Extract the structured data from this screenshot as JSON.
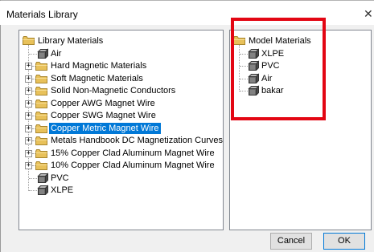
{
  "window": {
    "title": "Materials Library",
    "close_glyph": "✕"
  },
  "library_tree": {
    "root_label": "Library Materials",
    "items": [
      {
        "label": "Air",
        "kind": "material",
        "expandable": false
      },
      {
        "label": "Hard Magnetic Materials",
        "kind": "folder",
        "expandable": true
      },
      {
        "label": "Soft Magnetic Materials",
        "kind": "folder",
        "expandable": true
      },
      {
        "label": "Solid Non-Magnetic Conductors",
        "kind": "folder",
        "expandable": true
      },
      {
        "label": "Copper AWG Magnet Wire",
        "kind": "folder",
        "expandable": true
      },
      {
        "label": "Copper SWG Magnet Wire",
        "kind": "folder",
        "expandable": true
      },
      {
        "label": "Copper Metric Magnet Wire",
        "kind": "folder",
        "expandable": true,
        "selected": true
      },
      {
        "label": "Metals Handbook DC Magnetization Curves",
        "kind": "folder",
        "expandable": true
      },
      {
        "label": "15% Copper Clad Aluminum Magnet Wire",
        "kind": "folder",
        "expandable": true
      },
      {
        "label": "10% Copper Clad Aluminum Magnet Wire",
        "kind": "folder",
        "expandable": true
      },
      {
        "label": "PVC",
        "kind": "material",
        "expandable": false
      },
      {
        "label": "XLPE",
        "kind": "material",
        "expandable": false
      }
    ]
  },
  "model_tree": {
    "root_label": "Model Materials",
    "items": [
      {
        "label": "XLPE",
        "kind": "material"
      },
      {
        "label": "PVC",
        "kind": "material"
      },
      {
        "label": "Air",
        "kind": "material"
      },
      {
        "label": "bakar",
        "kind": "material"
      }
    ]
  },
  "buttons": {
    "cancel": "Cancel",
    "ok": "OK"
  },
  "colors": {
    "highlight": "#e30613",
    "selection": "#0078d7",
    "folder": "#e8c15a"
  },
  "icons": {
    "folder": "folder-icon",
    "material": "material-icon",
    "expander": "expand-plus-icon"
  }
}
